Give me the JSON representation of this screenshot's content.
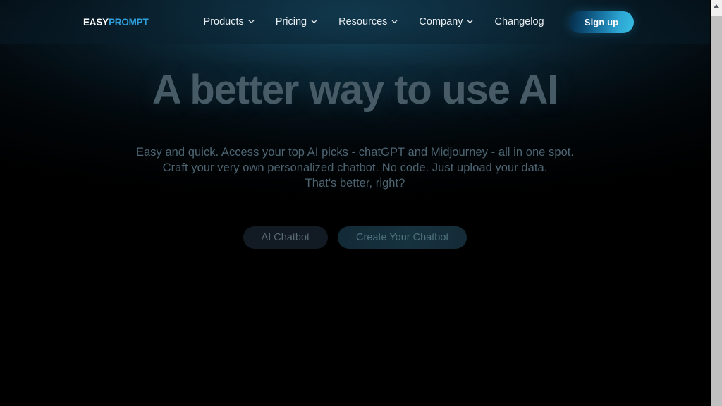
{
  "header": {
    "brand": {
      "part_one": "EASY",
      "part_two": "PROMPT",
      "part_one_color": "#ffffff",
      "part_two_color": "#2f9fdc"
    },
    "nav": [
      {
        "label": "Products",
        "has_dropdown": true,
        "icon": "chevron-down-icon"
      },
      {
        "label": "Pricing",
        "has_dropdown": true,
        "icon": "chevron-down-icon"
      },
      {
        "label": "Resources",
        "has_dropdown": true,
        "icon": "chevron-down-icon"
      },
      {
        "label": "Company",
        "has_dropdown": true,
        "icon": "chevron-down-icon"
      },
      {
        "label": "Changelog",
        "has_dropdown": false,
        "icon": ""
      }
    ],
    "signup_label": "Sign up",
    "signup_gradient_from": "#062a45",
    "signup_gradient_to": "#36bde2"
  },
  "hero": {
    "title": "A better way to use AI",
    "title_color": "#465b66",
    "subtitle_line_1": "Easy and quick. Access your top AI picks - chatGPT and Midjourney - all in one spot.",
    "subtitle_line_2": "Craft your very own personalized chatbot. No code. Just upload your data.",
    "subtitle_line_3": "That's better, right?",
    "subtitle_color": "#4d6573",
    "cta_secondary_label": "AI Chatbot",
    "cta_primary_label": "Create Your Chatbot"
  },
  "scrollbar": {
    "up_arrow_icon": "scroll-up-arrow-icon",
    "down_arrow_icon": "scroll-down-arrow-icon",
    "thumb_color": "#c0c0c0",
    "track_color": "#f0f0f0"
  },
  "theme": {
    "background": "#000000",
    "glow": "#174a63",
    "accent": "#2f9fdc"
  }
}
